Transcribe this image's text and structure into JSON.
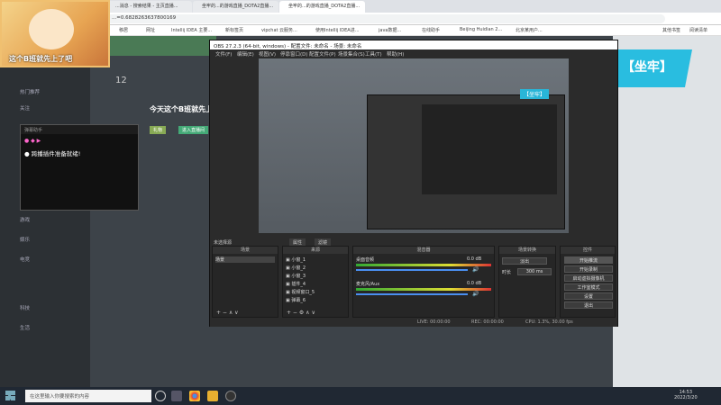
{
  "browser": {
    "tabs": [
      "...消息 - 搜索结果 - 主页直播...",
      "坐牢的...的游戏直播_DOTA2直播...",
      "坐牢的...的游戏直播_DOTA2直播..."
    ],
    "url": "...=0.6828263637800169",
    "bookmarks": [
      "移居",
      "网址",
      "Intellij IDEA 主要...",
      "新标签页",
      "vipchat 云服务...",
      "使用Intellij IDEA进...",
      "java数据...",
      "在线助手",
      "Beijing Huidian 2...",
      "北京某用户...",
      "其他书签",
      "阅读清单"
    ]
  },
  "site": {
    "stream_title": "今天这个B班就先上",
    "nav_items": [
      "热门推荐",
      "关注",
      "直播",
      "游戏",
      "娱乐",
      "电竞",
      "科技",
      "生活"
    ],
    "follow_count": "12",
    "badges": [
      "礼物",
      "进入直播间"
    ]
  },
  "avatar": {
    "caption": "这个B班就先上了吧"
  },
  "chat": {
    "header": "弹幕助手",
    "message": "跨播插件准备就绪!"
  },
  "obs": {
    "title": "OBS 27.2.3 (64-bit, windows) - 配置文件: 未命名 - 场景: 未命名",
    "menu": [
      "文件(F)",
      "编辑(E)",
      "视图(V)",
      "停靠窗口(D)",
      "配置文件(P)",
      "场景集合(S)",
      "工具(T)",
      "帮助(H)"
    ],
    "preview_badge_small": "【坐牢】",
    "preview_badge_big": "【坐牢】",
    "scene_bar_label": "未选择源",
    "scene_bar_buttons": [
      "属性",
      "滤镜"
    ],
    "docks": {
      "scenes": {
        "title": "场景",
        "items": [
          "场景"
        ]
      },
      "sources": {
        "title": "来源",
        "items": [
          "小窗_1",
          "小窗_2",
          "小窗_3",
          "插件_4",
          "视频窗口_5",
          "弹幕_6"
        ]
      },
      "mixer": {
        "title": "混音器",
        "tracks": [
          {
            "name": "桌面音频",
            "level": "0.0 dB"
          },
          {
            "name": "麦克风/Aux",
            "level": "0.0 dB"
          }
        ]
      },
      "transitions": {
        "title": "场景转换",
        "type": "淡出",
        "duration_label": "时长",
        "duration": "300 ms"
      },
      "controls": {
        "title": "控件",
        "buttons": [
          "开始推流",
          "开始录制",
          "启动虚拟摄像机",
          "工作室模式",
          "设置",
          "退出"
        ]
      }
    },
    "status": {
      "live": "LIVE: 00:00:00",
      "rec": "REC: 00:00:00",
      "cpu": "CPU: 1.3%, 30.00 fps"
    }
  },
  "taskbar": {
    "search_placeholder": "在这里输入你要搜索的内容",
    "time": "14:53",
    "date": "2022/3/20"
  },
  "colors": {
    "accent": "#29bde0",
    "bg": "#3d4349"
  }
}
